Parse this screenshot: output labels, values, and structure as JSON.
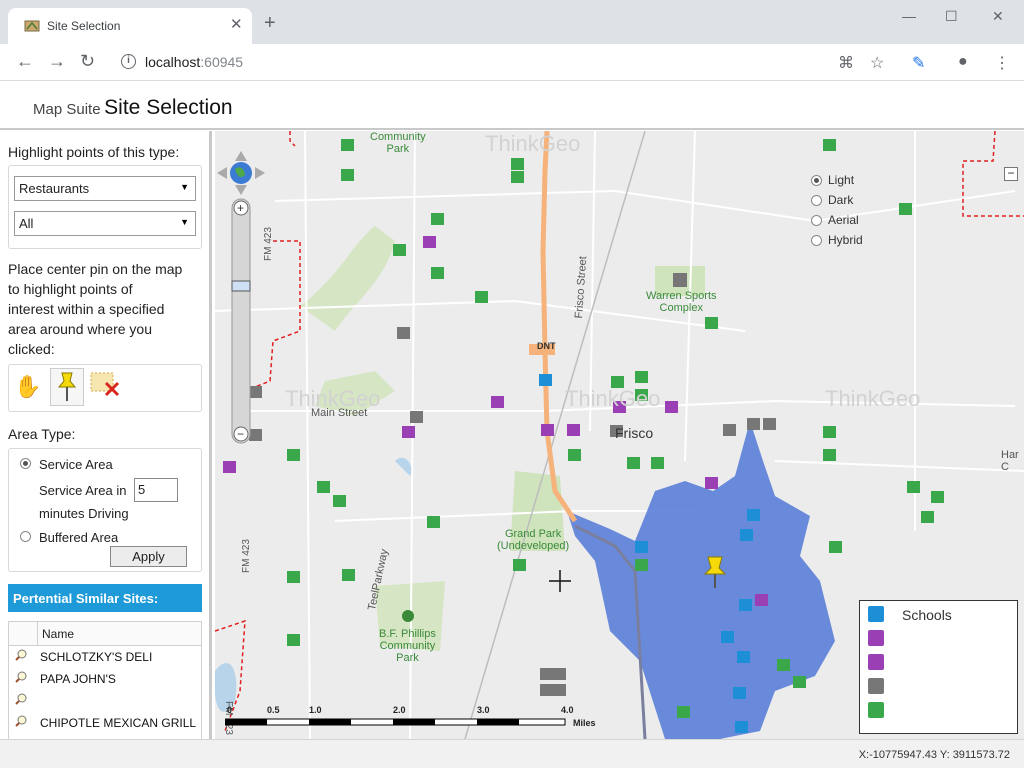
{
  "browser": {
    "tab_title": "Site Selection",
    "url_host": "localhost",
    "url_port": ":60945"
  },
  "header": {
    "brand_small": "Map Suite",
    "brand_big": "Site Selection"
  },
  "sidebar": {
    "highlight_label": "Highlight points of this type:",
    "type_select": "Restaurants",
    "subtype_select": "All",
    "instructions": [
      "Place center pin on the map",
      "to highlight points of",
      "interest within a specified",
      "area around where you",
      "clicked:"
    ],
    "area_type_label": "Area Type:",
    "service_area": "Service Area",
    "service_area_in": "Service Area in",
    "minutes_value": "5",
    "minutes_driving": "minutes Driving",
    "buffered_area": "Buffered Area",
    "apply": "Apply",
    "similar_sites_header": "Pertential Similar Sites:",
    "grid_column": "Name",
    "sites": [
      "SCHLOTZKY'S DELI",
      "PAPA JOHN'S",
      "",
      "CHIPOTLE MEXICAN GRILL"
    ]
  },
  "map": {
    "base_layers": [
      "Light",
      "Dark",
      "Aerial",
      "Hybrid"
    ],
    "selected_layer": "Light",
    "labels": {
      "community_park": "Community\nPark",
      "warren": "Warren Sports\nComplex",
      "frisco_street": "Frisco Street",
      "dnt": "DNT",
      "frisco": "Frisco",
      "main_street": "Main Street",
      "grand_park": "Grand Park\n(Undeveloped)",
      "teel": "TeelParkway",
      "bf_phillips": "B.F. Phillips\nCommunity\nPark",
      "fm423": "FM 423",
      "fm423b": "FM 423",
      "fm423c": "FM 423",
      "hare": "Har\nC",
      "watermark": "ThinkGeo"
    },
    "scale": {
      "ticks": [
        "0",
        "0.5",
        "1.0",
        "2.0",
        "3.0",
        "4.0"
      ],
      "unit": "Miles"
    },
    "legend": [
      {
        "label": "Schools",
        "color": "#1c8fd6"
      },
      {
        "label": "",
        "color": "#9b3fb5"
      },
      {
        "label": "",
        "color": "#9b3fb5"
      },
      {
        "label": "",
        "color": "#777777"
      },
      {
        "label": "",
        "color": "#3aa84a"
      }
    ]
  },
  "status": {
    "coords": "X:-10775947.43 Y: 3911573.72"
  },
  "colors": {
    "service_area": "#5b7fd8",
    "highway": "#f5b27a",
    "accent": "#1e9ad8"
  }
}
